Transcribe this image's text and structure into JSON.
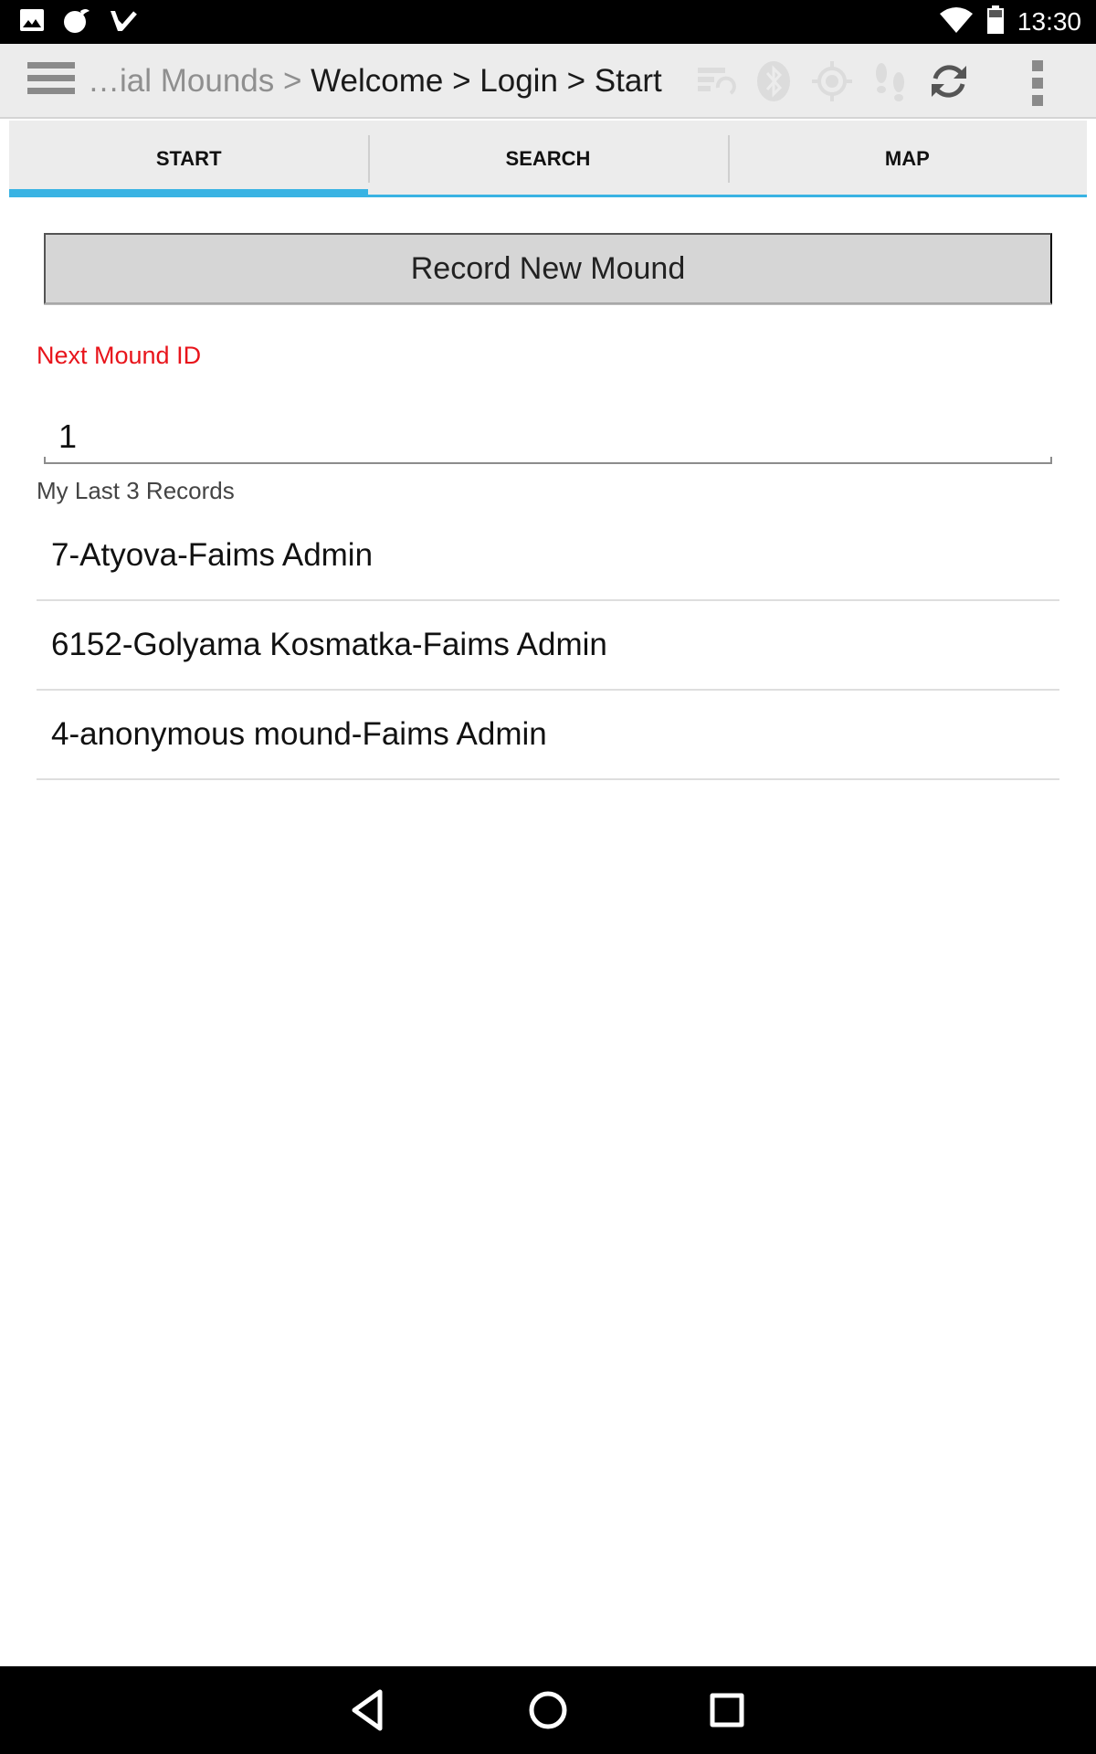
{
  "status_bar": {
    "time": "13:30",
    "left_icons": [
      "gallery-icon",
      "notification-app-icon",
      "task-check-icon"
    ],
    "right_icons": [
      "wifi-icon",
      "battery-icon"
    ]
  },
  "action_bar": {
    "breadcrumb_dim": "…ial Mounds > ",
    "breadcrumb_active": "Welcome > Login > Start",
    "icons": [
      "sync-list-icon",
      "bluetooth-icon",
      "gps-icon",
      "footsteps-icon",
      "refresh-icon",
      "overflow-menu-icon"
    ]
  },
  "tabs": [
    {
      "label": "START",
      "active": true
    },
    {
      "label": "SEARCH",
      "active": false
    },
    {
      "label": "MAP",
      "active": false
    }
  ],
  "main": {
    "record_button_label": "Record New Mound",
    "next_id_label": "Next Mound ID",
    "next_id_value": "1",
    "last_records_label": "My Last 3 Records",
    "records": [
      "7-Atyova-Faims Admin",
      "6152-Golyama Kosmatka-Faims Admin",
      "4-anonymous mound-Faims Admin"
    ]
  },
  "colors": {
    "accent": "#39b3e3",
    "label_red": "#e8141b",
    "action_bar_bg": "#ececec"
  }
}
